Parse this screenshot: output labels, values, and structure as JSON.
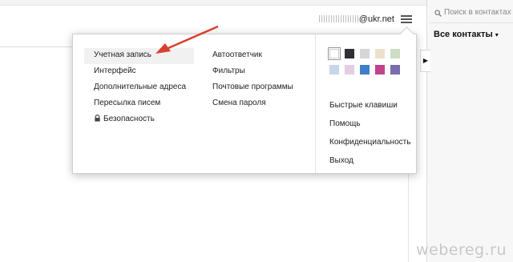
{
  "header": {
    "email_domain": "@ukr.net",
    "menu_icon": "hamburger-icon"
  },
  "contacts_panel": {
    "search_placeholder": "Поиск в контактах",
    "search_icon": "search-icon",
    "title": "Все контакты",
    "title_caret": "▾",
    "collapse_arrow": "▶"
  },
  "settings_menu": {
    "column1": [
      {
        "label": "Учетная запись",
        "active": true
      },
      {
        "label": "Интерфейс"
      },
      {
        "label": "Дополнительные адреса"
      },
      {
        "label": "Пересылка писем"
      },
      {
        "label": "Безопасность",
        "icon": "lock-icon"
      }
    ],
    "column2": [
      {
        "label": "Автоответчик"
      },
      {
        "label": "Фильтры"
      },
      {
        "label": "Почтовые программы"
      },
      {
        "label": "Смена пароля"
      }
    ],
    "theme_colors": [
      "#ffffff",
      "#2f2f36",
      "#d6d6d6",
      "#eae2cc",
      "#cfdcc5",
      "#c7d6ea",
      "#e3cfe5",
      "#3f7fc9",
      "#c0448b",
      "#7a6cab"
    ],
    "selected_theme_index": 0,
    "extra_links": [
      {
        "label": "Быстрые клавиши"
      },
      {
        "label": "Помощь"
      },
      {
        "label": "Конфиденциальность"
      },
      {
        "label": "Выход"
      }
    ]
  },
  "annotation_arrow_color": "#d9402b",
  "watermark": "webereg.ru"
}
